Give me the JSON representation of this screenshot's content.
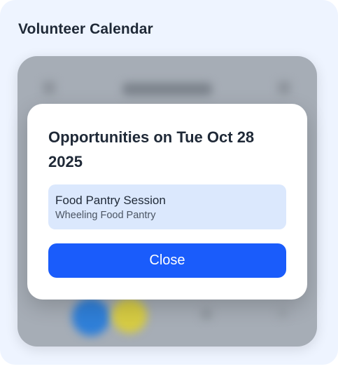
{
  "page": {
    "title": "Volunteer Calendar"
  },
  "modal": {
    "title": "Opportunities on Tue Oct 28 2025",
    "opportunities": [
      {
        "name": "Food Pantry Session",
        "organization": "Wheeling Food Pantry"
      }
    ],
    "close_label": "Close"
  },
  "colors": {
    "primary": "#1a5cfb",
    "opportunity_bg": "#dbe8fd",
    "overlay": "#a6adb6",
    "card_bg": "#eef4ff"
  }
}
